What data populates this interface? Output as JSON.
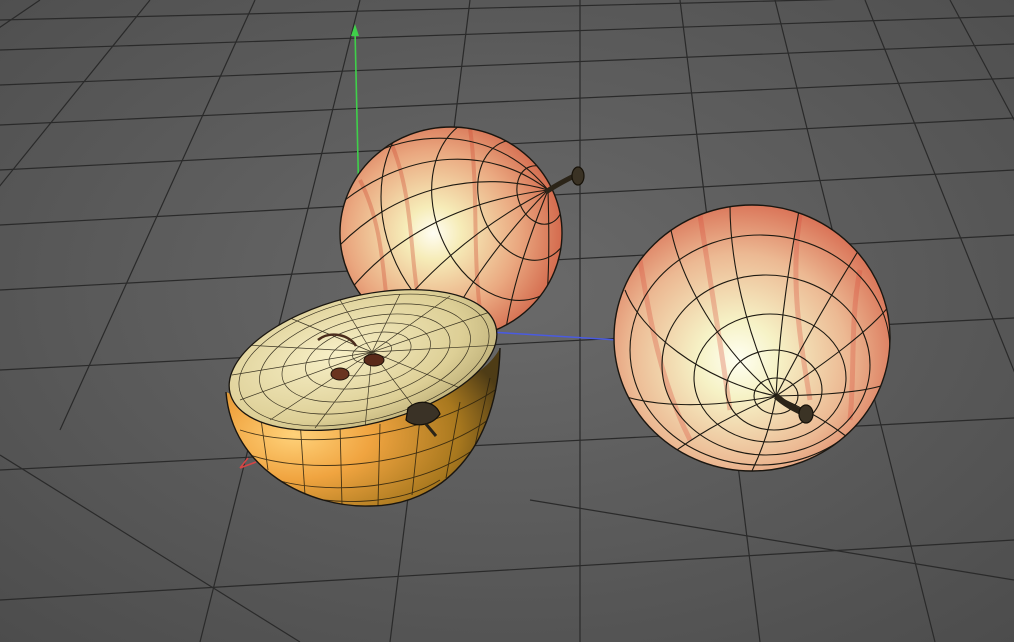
{
  "viewport": {
    "kind": "3d-perspective-viewport",
    "background_color": "#4a4a4a",
    "floor_color": "#5e5e5e",
    "grid_color": "#2a2a2a"
  },
  "axes": {
    "x_color": "#d64545",
    "y_color": "#3fd04a",
    "z_color": "#4a5be0"
  },
  "objects": [
    {
      "name": "apple-whole-back",
      "skin_colors": [
        "#f3e7b0",
        "#e9a37a",
        "#d95c3c"
      ],
      "wireframe": true
    },
    {
      "name": "apple-whole-right",
      "skin_colors": [
        "#f4efc0",
        "#ebb28c",
        "#d85a44"
      ],
      "wireframe": true
    },
    {
      "name": "apple-half",
      "flesh_color": "#e9dca6",
      "skin_colors": [
        "#f0b040",
        "#c07a2a"
      ],
      "wireframe": true
    }
  ]
}
